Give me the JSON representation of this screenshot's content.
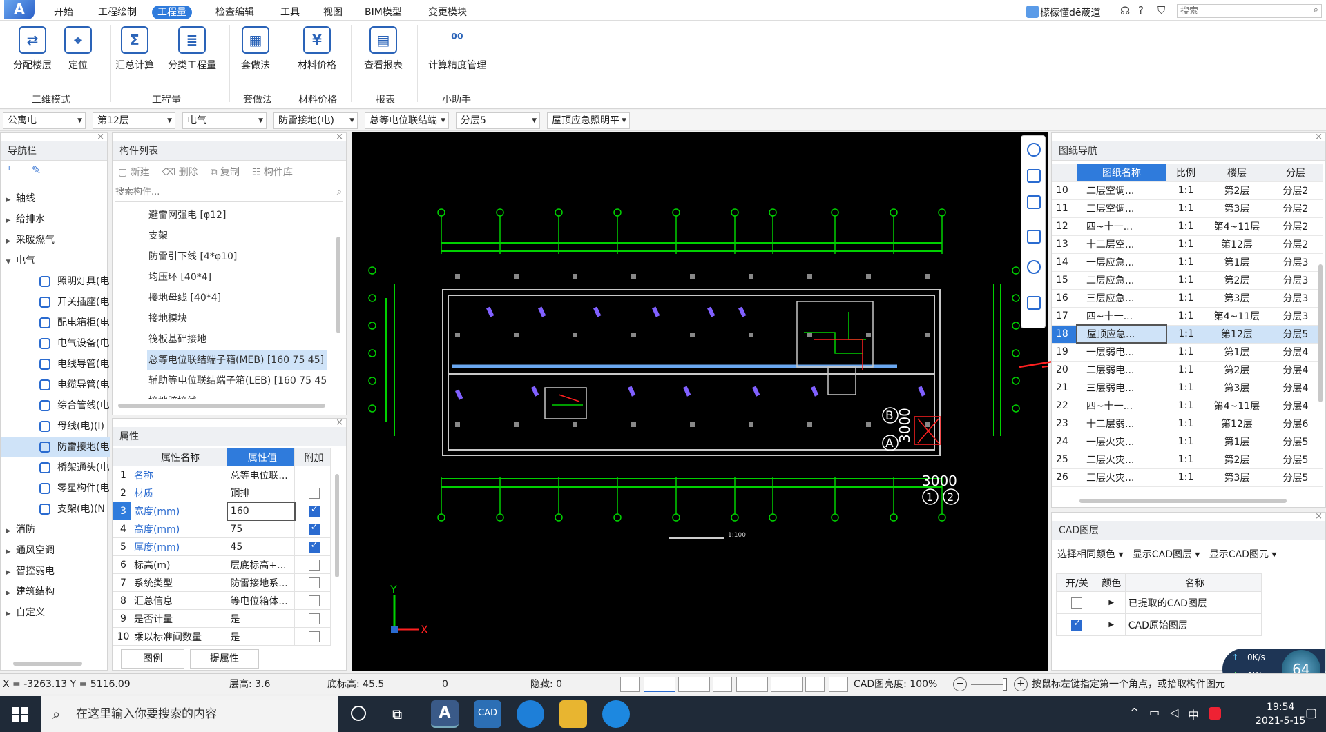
{
  "menu": {
    "items": [
      "开始",
      "工程绘制",
      "工程量",
      "检查编辑",
      "工具",
      "视图",
      "BIM模型",
      "变更模块"
    ],
    "active_index": 2,
    "user_name": "檬檬懂dē荿道",
    "help": "?",
    "search_placeholder": "搜索"
  },
  "ribbon": {
    "buttons": [
      {
        "label": "分配楼层",
        "glyph": "⇄"
      },
      {
        "label": "定位",
        "glyph": "⌖"
      },
      {
        "label": "汇总计算",
        "glyph": "Σ"
      },
      {
        "label": "分类工程量",
        "glyph": "≣"
      },
      {
        "label": "套做法",
        "glyph": "▦"
      },
      {
        "label": "材料价格",
        "glyph": "¥"
      },
      {
        "label": "查看报表",
        "glyph": "▤"
      },
      {
        "label": "计算精度管理",
        "glyph": "⁰⁰"
      }
    ],
    "groups": [
      "三维模式",
      "工程量",
      "套做法",
      "材料价格",
      "报表",
      "小助手"
    ]
  },
  "filters": [
    "公寓电",
    "第12层",
    "电气",
    "防雷接地(电)",
    "总等电位联结端",
    "分层5",
    "屋顶应急照明平"
  ],
  "nav": {
    "title": "导航栏",
    "top_items": [
      "轴线",
      "给排水",
      "采暖燃气",
      "电气"
    ],
    "sub_items": [
      "照明灯具(电",
      "开关插座(电",
      "配电箱柜(电",
      "电气设备(电",
      "电线导管(电",
      "电缆导管(电",
      "综合管线(电",
      "母线(电)(I)",
      "防雷接地(电",
      "桥架通头(电",
      "零星构件(电",
      "支架(电)(N"
    ],
    "selected_sub": 8,
    "bottom_items": [
      "消防",
      "通风空调",
      "智控弱电",
      "建筑结构",
      "自定义"
    ]
  },
  "components": {
    "title": "构件列表",
    "toolbar": [
      "新建",
      "删除",
      "复制",
      "构件库"
    ],
    "search_placeholder": "搜索构件...",
    "items": [
      "避雷网强电 [φ12]",
      "支架",
      "防雷引下线 [4*φ10]",
      "均压环 [40*4]",
      "接地母线 [40*4]",
      "接地模块",
      "筏板基础接地",
      "总等电位联结端子箱(MEB) [160 75 45]",
      "辅助等电位联结端子箱(LEB) [160 75 45",
      "接地跨接线"
    ],
    "selected": 7
  },
  "properties": {
    "title": "属性",
    "headers": [
      "属性名称",
      "属性值",
      "附加"
    ],
    "rows": [
      {
        "n": "1",
        "name": "名称",
        "value": "总等电位联...",
        "check": null,
        "blue": true
      },
      {
        "n": "2",
        "name": "材质",
        "value": "铜排",
        "check": false,
        "blue": true
      },
      {
        "n": "3",
        "name": "宽度(mm)",
        "value": "160",
        "check": true,
        "blue": true
      },
      {
        "n": "4",
        "name": "高度(mm)",
        "value": "75",
        "check": true,
        "blue": true
      },
      {
        "n": "5",
        "name": "厚度(mm)",
        "value": "45",
        "check": true,
        "blue": true
      },
      {
        "n": "6",
        "name": "标高(m)",
        "value": "层底标高+...",
        "check": false,
        "blue": false
      },
      {
        "n": "7",
        "name": "系统类型",
        "value": "防雷接地系...",
        "check": false,
        "blue": false
      },
      {
        "n": "8",
        "name": "汇总信息",
        "value": "等电位箱体...",
        "check": false,
        "blue": false
      },
      {
        "n": "9",
        "name": "是否计量",
        "value": "是",
        "check": false,
        "blue": false
      },
      {
        "n": "10",
        "name": "乘以标准间数量",
        "value": "是",
        "check": false,
        "blue": false
      }
    ],
    "buttons": [
      "图例",
      "提属性"
    ]
  },
  "canvas": {
    "labels": {
      "b": "B",
      "a": "A",
      "dim_v": "3000",
      "dim_h": "3000",
      "one": "1",
      "two": "2",
      "scale": "1:100",
      "axis_x": "X",
      "axis_y": "Y"
    }
  },
  "drawings": {
    "title": "图纸导航",
    "headers": [
      "图纸名称",
      "比例",
      "楼层",
      "分层"
    ],
    "rows": [
      [
        "10",
        "二层空调...",
        "1:1",
        "第2层",
        "分层2"
      ],
      [
        "11",
        "三层空调...",
        "1:1",
        "第3层",
        "分层2"
      ],
      [
        "12",
        "四~十一...",
        "1:1",
        "第4~11层",
        "分层2"
      ],
      [
        "13",
        "十二层空...",
        "1:1",
        "第12层",
        "分层2"
      ],
      [
        "14",
        "一层应急...",
        "1:1",
        "第1层",
        "分层3"
      ],
      [
        "15",
        "二层应急...",
        "1:1",
        "第2层",
        "分层3"
      ],
      [
        "16",
        "三层应急...",
        "1:1",
        "第3层",
        "分层3"
      ],
      [
        "17",
        "四~十一...",
        "1:1",
        "第4~11层",
        "分层3"
      ],
      [
        "18",
        "屋顶应急...",
        "1:1",
        "第12层",
        "分层5"
      ],
      [
        "19",
        "一层弱电...",
        "1:1",
        "第1层",
        "分层4"
      ],
      [
        "20",
        "二层弱电...",
        "1:1",
        "第2层",
        "分层4"
      ],
      [
        "21",
        "三层弱电...",
        "1:1",
        "第3层",
        "分层4"
      ],
      [
        "22",
        "四~十一...",
        "1:1",
        "第4~11层",
        "分层4"
      ],
      [
        "23",
        "十二层弱...",
        "1:1",
        "第12层",
        "分层6"
      ],
      [
        "24",
        "一层火灾...",
        "1:1",
        "第1层",
        "分层5"
      ],
      [
        "25",
        "二层火灾...",
        "1:1",
        "第2层",
        "分层5"
      ],
      [
        "26",
        "三层火灾...",
        "1:1",
        "第3层",
        "分层5"
      ]
    ],
    "selected": 8
  },
  "cad": {
    "title": "CAD图层",
    "toolbar": [
      "选择相同颜色",
      "显示CAD图层",
      "显示CAD图元"
    ],
    "headers": [
      "开/关",
      "颜色",
      "名称"
    ],
    "rows": [
      {
        "name": "已提取的CAD图层",
        "on": false
      },
      {
        "name": "CAD原始图层",
        "on": true
      }
    ]
  },
  "status": {
    "coords": "X = -3263.13 Y = 5116.09",
    "floor_height": "层高: 3.6",
    "bottom_elev": "底标高: 45.5",
    "zero": "0",
    "hidden": "隐藏: 0",
    "brightness": "CAD图亮度: 100%",
    "hint": "按鼠标左键指定第一个角点，或拾取构件图元"
  },
  "speed": {
    "up": "0K/s",
    "down": "0K/s",
    "pct": "64"
  },
  "taskbar": {
    "search_text": "在这里输入你要搜索的内容",
    "time": "19:54",
    "date": "2021-5-15",
    "ime": "中"
  },
  "colors": {
    "accent": "#2f7bdc",
    "selected_row": "#cfe3f8",
    "cad_green": "#00d000",
    "cad_purple": "#8060ff",
    "cad_red": "#ff2020"
  }
}
